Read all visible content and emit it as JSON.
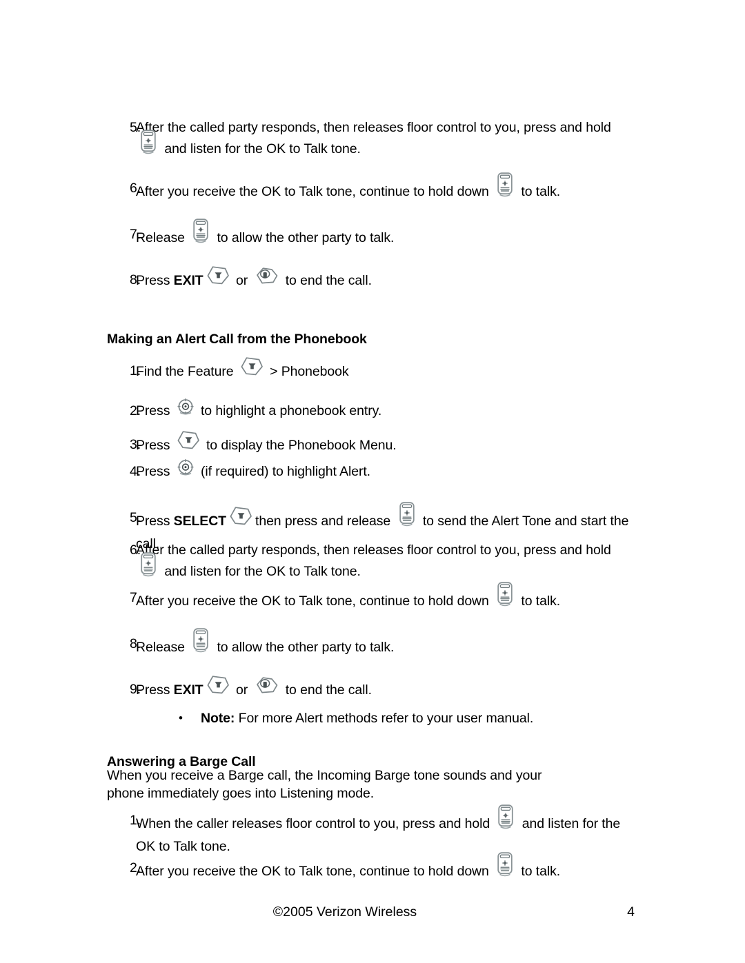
{
  "document": {
    "footer": {
      "copyright": "©2005 Verizon Wireless",
      "page_number": "4"
    }
  },
  "icons": {
    "ptt": "ptt-side-key-icon",
    "softkey": "soft-key-icon",
    "endkey": "end-call-key-icon",
    "navkey": "navigation-key-icon"
  },
  "sections": [
    {
      "id": "continued-steps",
      "heading": null,
      "steps": [
        {
          "num": "5.",
          "parts": [
            {
              "t": "text",
              "v": "After the called party responds, then releases floor control to you, press and hold "
            },
            {
              "t": "icon",
              "v": "ptt"
            },
            {
              "t": "text",
              "v": " and listen for the OK to Talk tone."
            }
          ]
        },
        {
          "num": "6.",
          "parts": [
            {
              "t": "text",
              "v": "After you receive the OK to Talk tone, continue to hold down "
            },
            {
              "t": "icon",
              "v": "ptt"
            },
            {
              "t": "text",
              "v": " to talk."
            }
          ]
        },
        {
          "num": "7.",
          "parts": [
            {
              "t": "text",
              "v": "Release "
            },
            {
              "t": "icon",
              "v": "ptt"
            },
            {
              "t": "text",
              "v": " to allow the other party to talk."
            }
          ]
        },
        {
          "num": "8.",
          "parts": [
            {
              "t": "text",
              "v": "Press "
            },
            {
              "t": "bold",
              "v": "EXIT"
            },
            {
              "t": "icon",
              "v": "softkey"
            },
            {
              "t": "text",
              "v": " or "
            },
            {
              "t": "icon",
              "v": "endkey"
            },
            {
              "t": "text",
              "v": " to end the call."
            }
          ]
        }
      ]
    },
    {
      "id": "making-alert-call-from-phonebook",
      "heading": "Making an Alert Call from the Phonebook",
      "steps": [
        {
          "num": "1.",
          "parts": [
            {
              "t": "text",
              "v": "Find the Feature "
            },
            {
              "t": "icon",
              "v": "softkey"
            },
            {
              "t": "text",
              "v": " > Phonebook"
            }
          ]
        },
        {
          "num": "2.",
          "parts": [
            {
              "t": "text",
              "v": "Press "
            },
            {
              "t": "icon",
              "v": "navkey"
            },
            {
              "t": "text",
              "v": " to highlight a phonebook entry."
            }
          ]
        },
        {
          "num": "3.",
          "parts": [
            {
              "t": "text",
              "v": "Press "
            },
            {
              "t": "icon",
              "v": "softkey"
            },
            {
              "t": "text",
              "v": " to display the Phonebook Menu."
            }
          ]
        },
        {
          "num": "4.",
          "parts": [
            {
              "t": "text",
              "v": "Press "
            },
            {
              "t": "icon",
              "v": "navkey"
            },
            {
              "t": "text",
              "v": " (if required) to highlight Alert."
            }
          ]
        },
        {
          "num": "5.",
          "parts": [
            {
              "t": "text",
              "v": "Press "
            },
            {
              "t": "bold",
              "v": "SELECT"
            },
            {
              "t": "icon",
              "v": "softkey"
            },
            {
              "t": "text",
              "v": "then press and release "
            },
            {
              "t": "icon",
              "v": "ptt"
            },
            {
              "t": "text",
              "v": " to send the Alert Tone and start the call."
            }
          ]
        },
        {
          "num": "6.",
          "parts": [
            {
              "t": "text",
              "v": "After the called party responds, then releases floor control to you, press and hold "
            },
            {
              "t": "icon",
              "v": "ptt"
            },
            {
              "t": "text",
              "v": " and listen for the OK to Talk tone."
            }
          ]
        },
        {
          "num": "7.",
          "parts": [
            {
              "t": "text",
              "v": "After you receive the OK to Talk tone, continue to hold down "
            },
            {
              "t": "icon",
              "v": "ptt"
            },
            {
              "t": "text",
              "v": " to talk."
            }
          ]
        },
        {
          "num": "8.",
          "parts": [
            {
              "t": "text",
              "v": "Release "
            },
            {
              "t": "icon",
              "v": "ptt"
            },
            {
              "t": "text",
              "v": " to allow the other party to talk."
            }
          ]
        },
        {
          "num": "9.",
          "parts": [
            {
              "t": "text",
              "v": "Press "
            },
            {
              "t": "bold",
              "v": "EXIT"
            },
            {
              "t": "icon",
              "v": "softkey"
            },
            {
              "t": "text",
              "v": " or "
            },
            {
              "t": "icon",
              "v": "endkey"
            },
            {
              "t": "text",
              "v": " to end the call."
            }
          ]
        }
      ],
      "note": {
        "bullet": "•",
        "label": "Note:",
        "text": " For more Alert methods refer to your user manual."
      }
    },
    {
      "id": "answering-a-barge-call",
      "heading": "Answering a Barge Call",
      "intro": "When you receive a Barge call, the Incoming Barge tone sounds and your phone immediately goes into Listening mode.",
      "steps": [
        {
          "num": "1.",
          "parts": [
            {
              "t": "text",
              "v": "When the caller releases floor control to you, press and hold "
            },
            {
              "t": "icon",
              "v": "ptt"
            },
            {
              "t": "text",
              "v": " and listen for the OK to Talk tone."
            }
          ]
        },
        {
          "num": "2.",
          "parts": [
            {
              "t": "text",
              "v": "After you receive the OK to Talk tone, continue to hold down "
            },
            {
              "t": "icon",
              "v": "ptt"
            },
            {
              "t": "text",
              "v": " to talk."
            }
          ]
        }
      ]
    }
  ]
}
